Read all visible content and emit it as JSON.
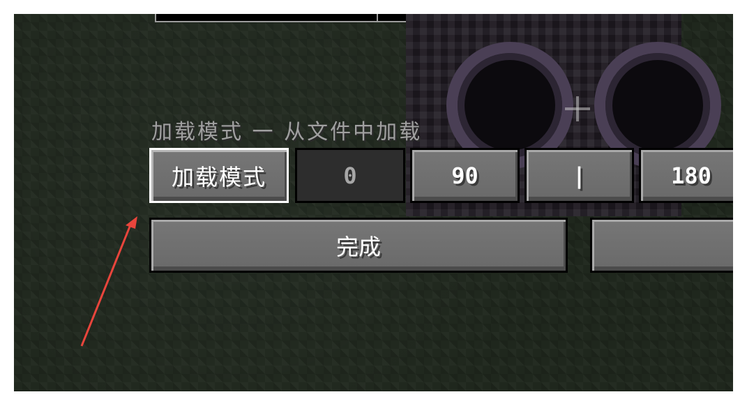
{
  "colors": {
    "annotation_arrow": "#e8453c",
    "button_face": "#6f6f6f",
    "selected_border": "#ffffff"
  },
  "label": {
    "mode_text": "加载模式 一 从文件中加载"
  },
  "buttons": {
    "mode": "加载模式",
    "rot0": "0",
    "rot90": "90",
    "separator": "|",
    "rot180": "180",
    "done": "完成",
    "right": ""
  },
  "icons": {
    "crosshair": "crosshair-icon",
    "arrow": "red-arrow-annotation"
  }
}
